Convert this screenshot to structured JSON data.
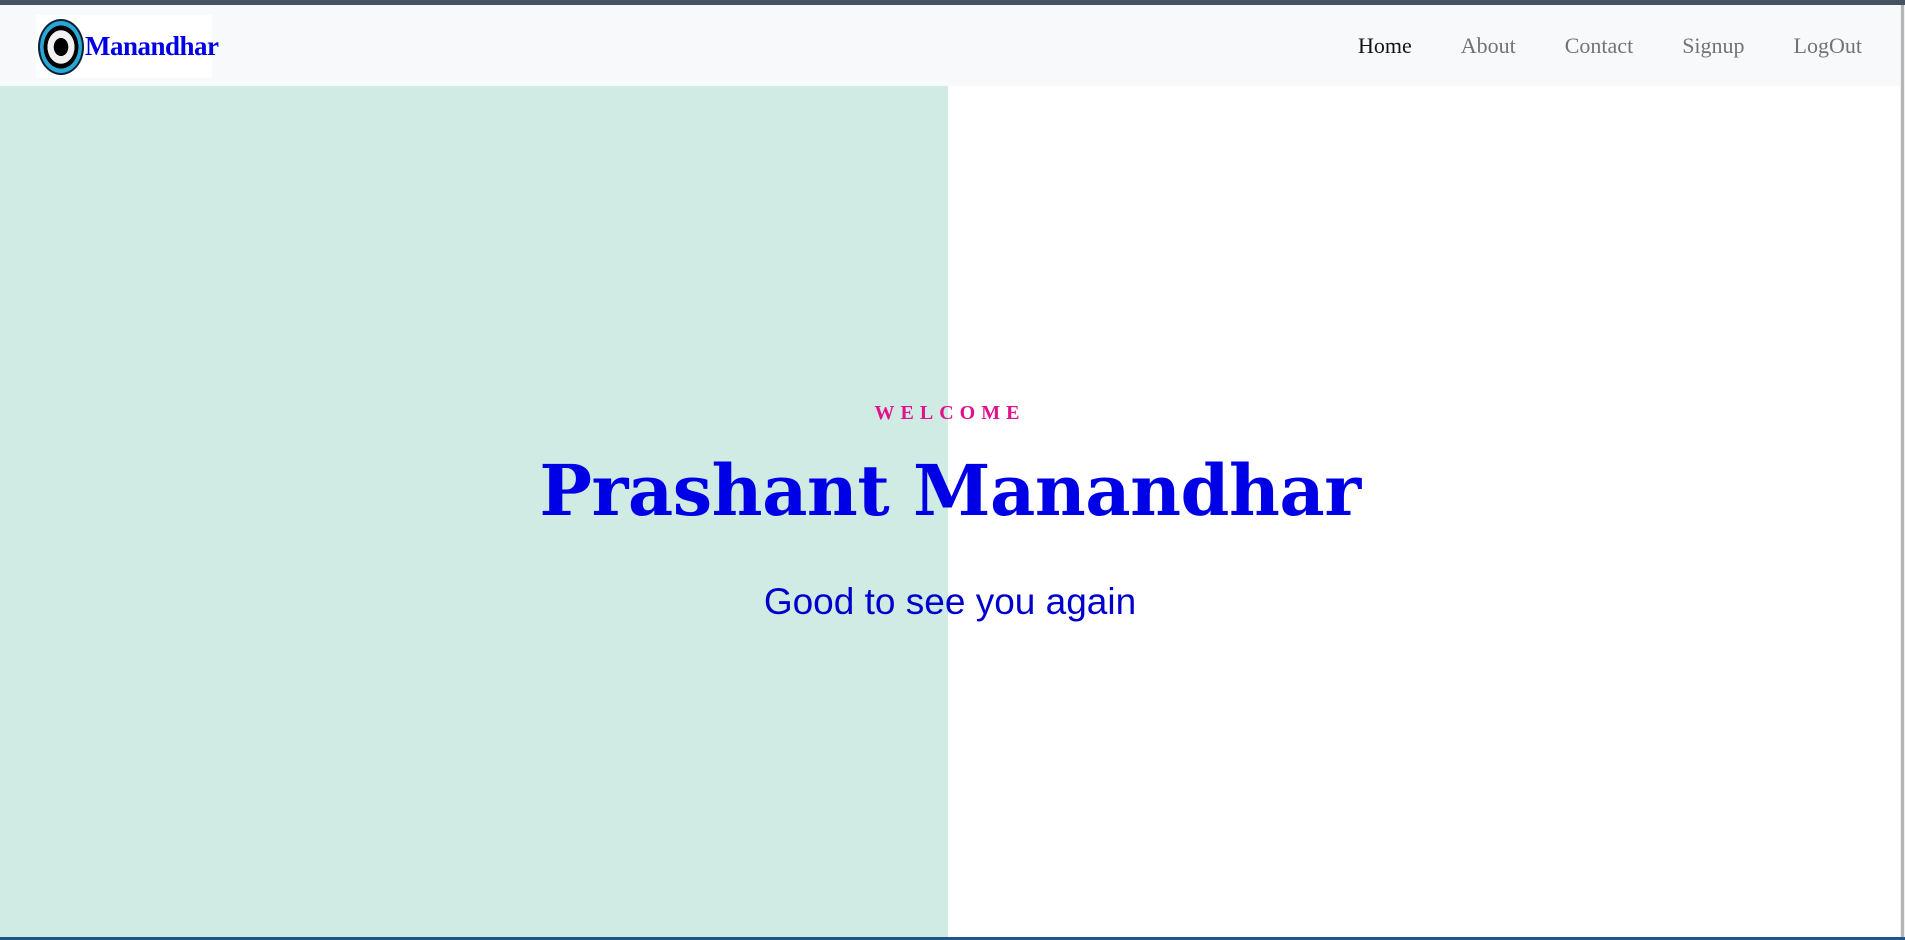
{
  "brand": {
    "logo_text": "Manandhar",
    "logo_icon": "eye-logo-icon"
  },
  "nav": {
    "items": [
      {
        "label": "Home",
        "active": true
      },
      {
        "label": "About",
        "active": false
      },
      {
        "label": "Contact",
        "active": false
      },
      {
        "label": "Signup",
        "active": false
      },
      {
        "label": "LogOut",
        "active": false
      }
    ]
  },
  "hero": {
    "kicker": "WELCOME",
    "name": "Prashant Manandhar",
    "greeting": "Good to see you again"
  },
  "colors": {
    "navbar_bg": "#f8f9fa",
    "left_panel_bg": "#d0ebe4",
    "kicker": "#e0128b",
    "heading": "#0000e6",
    "greeting": "#0000cc"
  }
}
